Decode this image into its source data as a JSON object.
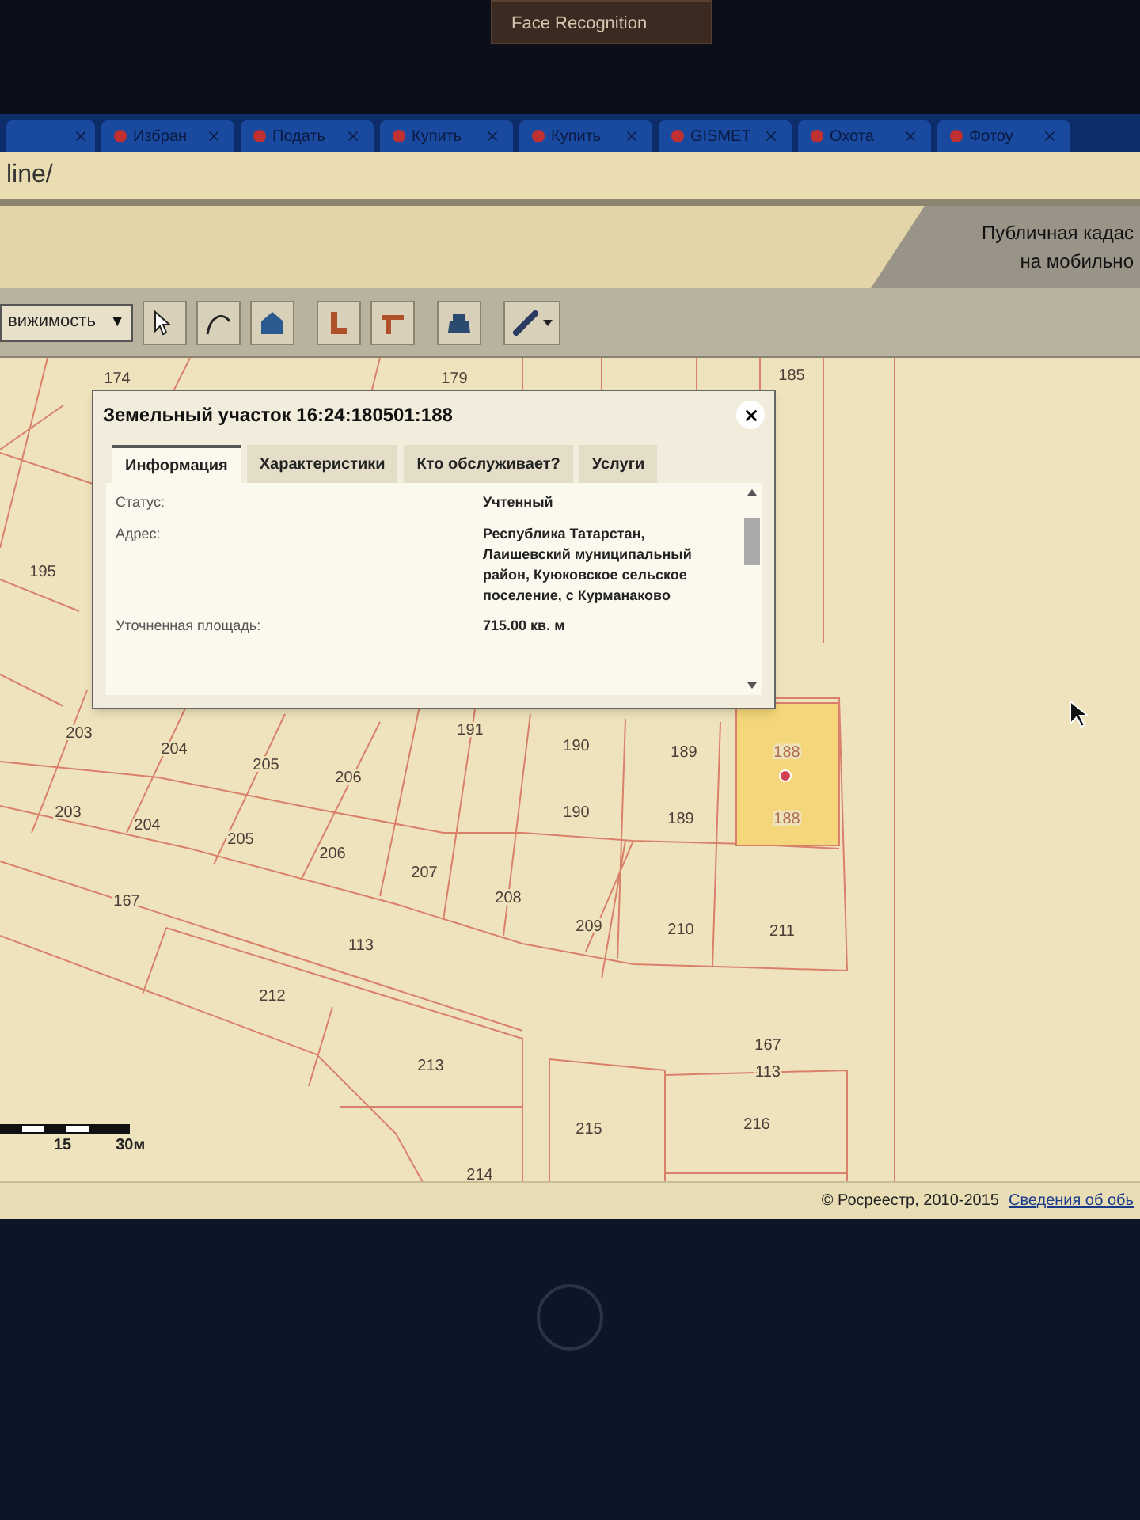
{
  "sticker": {
    "text": "Face Recognition"
  },
  "browser_tabs": [
    {
      "label": "Избран",
      "selected": false
    },
    {
      "label": "Подать",
      "selected": false
    },
    {
      "label": "Купить",
      "selected": false
    },
    {
      "label": "Купить",
      "selected": false
    },
    {
      "label": "GISMET",
      "selected": false
    },
    {
      "label": "Охота",
      "selected": false
    },
    {
      "label": "Фотоу",
      "selected": false
    }
  ],
  "address_bar": {
    "value": "line/"
  },
  "header": {
    "title_line_1": "Публичная кадас",
    "title_line_2": "на мобильно"
  },
  "toolbar": {
    "dropdown": {
      "value": "вижимость",
      "caret": "▼"
    }
  },
  "popup": {
    "title": "Земельный участок 16:24:180501:188",
    "tabs": [
      {
        "label": "Информация",
        "selected": true
      },
      {
        "label": "Характеристики",
        "selected": false
      },
      {
        "label": "Кто обслуживает?",
        "selected": false
      },
      {
        "label": "Услуги",
        "selected": false
      }
    ],
    "rows": [
      {
        "label": "Статус:",
        "value": "Учтенный"
      },
      {
        "label": "Адрес:",
        "value": "Республика Татарстан, Лаишевский муниципальный район, Куюковское сельское поселение, с Курманаково"
      },
      {
        "label": "Уточненная площадь:",
        "value": "715.00 кв. м"
      }
    ]
  },
  "map": {
    "parcels": [
      {
        "label": "174",
        "selected": false
      },
      {
        "label": "179",
        "selected": false
      },
      {
        "label": "185",
        "selected": false
      },
      {
        "label": "195",
        "selected": false
      },
      {
        "label": "203",
        "selected": false
      },
      {
        "label": "204",
        "selected": false
      },
      {
        "label": "205",
        "selected": false
      },
      {
        "label": "206",
        "selected": false
      },
      {
        "label": "191",
        "selected": false
      },
      {
        "label": "190",
        "selected": false
      },
      {
        "label": "189",
        "selected": false
      },
      {
        "label": "188",
        "selected": true
      },
      {
        "label": "203",
        "selected": false
      },
      {
        "label": "204",
        "selected": false
      },
      {
        "label": "205",
        "selected": false
      },
      {
        "label": "206",
        "selected": false
      },
      {
        "label": "207",
        "selected": false
      },
      {
        "label": "190",
        "selected": false
      },
      {
        "label": "189",
        "selected": false
      },
      {
        "label": "188",
        "selected": true
      },
      {
        "label": "167",
        "selected": false
      },
      {
        "label": "208",
        "selected": false
      },
      {
        "label": "209",
        "selected": false
      },
      {
        "label": "210",
        "selected": false
      },
      {
        "label": "211",
        "selected": false
      },
      {
        "label": "113",
        "selected": false
      },
      {
        "label": "212",
        "selected": false
      },
      {
        "label": "167",
        "selected": false
      },
      {
        "label": "113",
        "selected": false
      },
      {
        "label": "213",
        "selected": false
      },
      {
        "label": "215",
        "selected": false
      },
      {
        "label": "216",
        "selected": false
      },
      {
        "label": "214",
        "selected": false
      }
    ],
    "scale": {
      "ticks": [
        "15",
        "30м"
      ]
    }
  },
  "footer": {
    "copyright": "© Росреестр, 2010-2015",
    "link": "Сведения об обь"
  }
}
